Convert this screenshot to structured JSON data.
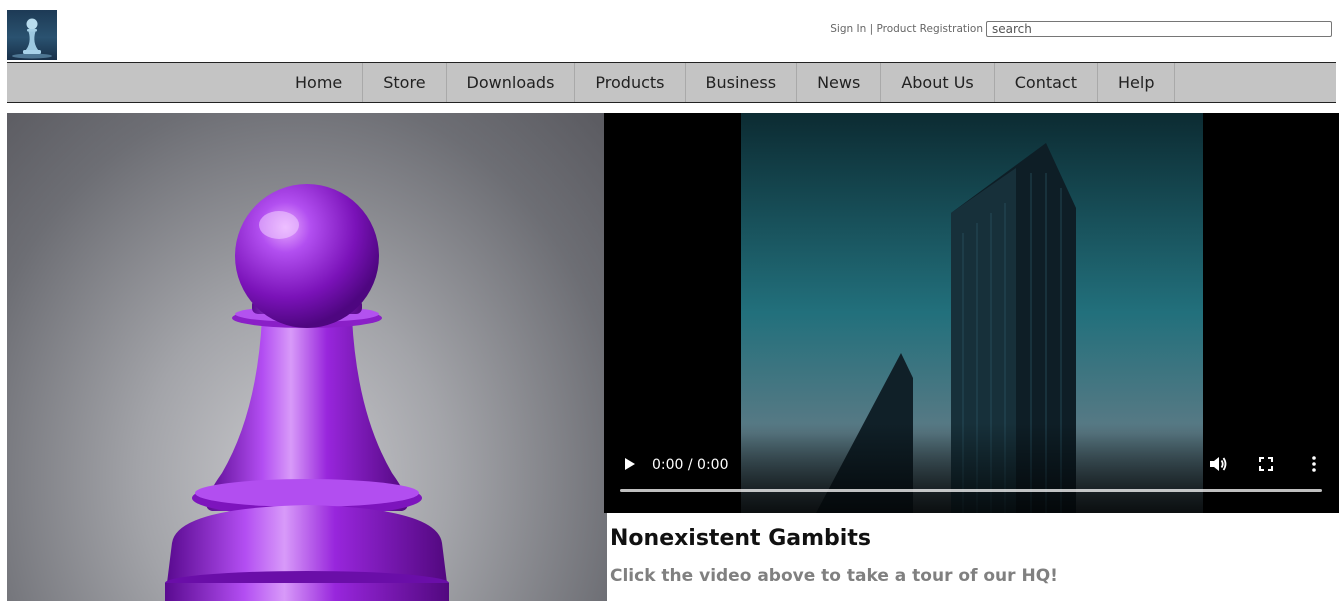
{
  "header": {
    "logo_icon": "chess-pawn-logo-icon",
    "sign_in_label": "Sign In",
    "separator": " | ",
    "product_registration_label": "Product Registration",
    "search": {
      "placeholder": "search",
      "value": ""
    }
  },
  "nav": {
    "items": [
      {
        "label": "Home"
      },
      {
        "label": "Store"
      },
      {
        "label": "Downloads"
      },
      {
        "label": "Products"
      },
      {
        "label": "Business"
      },
      {
        "label": "News"
      },
      {
        "label": "About Us"
      },
      {
        "label": "Contact"
      },
      {
        "label": "Help"
      }
    ]
  },
  "hero": {
    "image": "purple-chess-pawn-image"
  },
  "video": {
    "thumbnail": "skyscraper-thumbnail",
    "time": "0:00 / 0:00",
    "progress": 0,
    "icons": {
      "play": "play-icon",
      "volume": "volume-icon",
      "fullscreen": "fullscreen-icon",
      "more": "more-options-icon"
    }
  },
  "feature": {
    "title": "Nonexistent Gambits",
    "caption": "Click the video above to take a tour of our HQ!"
  },
  "colors": {
    "nav_background": "#c4c4c4",
    "pawn_purple": "#8a1fc7",
    "caption_gray": "#808080"
  }
}
